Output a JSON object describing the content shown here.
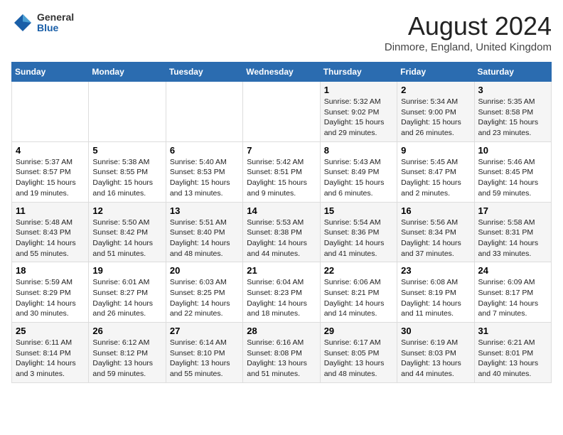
{
  "header": {
    "logo_general": "General",
    "logo_blue": "Blue",
    "title": "August 2024",
    "subtitle": "Dinmore, England, United Kingdom"
  },
  "days_of_week": [
    "Sunday",
    "Monday",
    "Tuesday",
    "Wednesday",
    "Thursday",
    "Friday",
    "Saturday"
  ],
  "weeks": [
    [
      {
        "num": "",
        "info": ""
      },
      {
        "num": "",
        "info": ""
      },
      {
        "num": "",
        "info": ""
      },
      {
        "num": "",
        "info": ""
      },
      {
        "num": "1",
        "info": "Sunrise: 5:32 AM\nSunset: 9:02 PM\nDaylight: 15 hours\nand 29 minutes."
      },
      {
        "num": "2",
        "info": "Sunrise: 5:34 AM\nSunset: 9:00 PM\nDaylight: 15 hours\nand 26 minutes."
      },
      {
        "num": "3",
        "info": "Sunrise: 5:35 AM\nSunset: 8:58 PM\nDaylight: 15 hours\nand 23 minutes."
      }
    ],
    [
      {
        "num": "4",
        "info": "Sunrise: 5:37 AM\nSunset: 8:57 PM\nDaylight: 15 hours\nand 19 minutes."
      },
      {
        "num": "5",
        "info": "Sunrise: 5:38 AM\nSunset: 8:55 PM\nDaylight: 15 hours\nand 16 minutes."
      },
      {
        "num": "6",
        "info": "Sunrise: 5:40 AM\nSunset: 8:53 PM\nDaylight: 15 hours\nand 13 minutes."
      },
      {
        "num": "7",
        "info": "Sunrise: 5:42 AM\nSunset: 8:51 PM\nDaylight: 15 hours\nand 9 minutes."
      },
      {
        "num": "8",
        "info": "Sunrise: 5:43 AM\nSunset: 8:49 PM\nDaylight: 15 hours\nand 6 minutes."
      },
      {
        "num": "9",
        "info": "Sunrise: 5:45 AM\nSunset: 8:47 PM\nDaylight: 15 hours\nand 2 minutes."
      },
      {
        "num": "10",
        "info": "Sunrise: 5:46 AM\nSunset: 8:45 PM\nDaylight: 14 hours\nand 59 minutes."
      }
    ],
    [
      {
        "num": "11",
        "info": "Sunrise: 5:48 AM\nSunset: 8:43 PM\nDaylight: 14 hours\nand 55 minutes."
      },
      {
        "num": "12",
        "info": "Sunrise: 5:50 AM\nSunset: 8:42 PM\nDaylight: 14 hours\nand 51 minutes."
      },
      {
        "num": "13",
        "info": "Sunrise: 5:51 AM\nSunset: 8:40 PM\nDaylight: 14 hours\nand 48 minutes."
      },
      {
        "num": "14",
        "info": "Sunrise: 5:53 AM\nSunset: 8:38 PM\nDaylight: 14 hours\nand 44 minutes."
      },
      {
        "num": "15",
        "info": "Sunrise: 5:54 AM\nSunset: 8:36 PM\nDaylight: 14 hours\nand 41 minutes."
      },
      {
        "num": "16",
        "info": "Sunrise: 5:56 AM\nSunset: 8:34 PM\nDaylight: 14 hours\nand 37 minutes."
      },
      {
        "num": "17",
        "info": "Sunrise: 5:58 AM\nSunset: 8:31 PM\nDaylight: 14 hours\nand 33 minutes."
      }
    ],
    [
      {
        "num": "18",
        "info": "Sunrise: 5:59 AM\nSunset: 8:29 PM\nDaylight: 14 hours\nand 30 minutes."
      },
      {
        "num": "19",
        "info": "Sunrise: 6:01 AM\nSunset: 8:27 PM\nDaylight: 14 hours\nand 26 minutes."
      },
      {
        "num": "20",
        "info": "Sunrise: 6:03 AM\nSunset: 8:25 PM\nDaylight: 14 hours\nand 22 minutes."
      },
      {
        "num": "21",
        "info": "Sunrise: 6:04 AM\nSunset: 8:23 PM\nDaylight: 14 hours\nand 18 minutes."
      },
      {
        "num": "22",
        "info": "Sunrise: 6:06 AM\nSunset: 8:21 PM\nDaylight: 14 hours\nand 14 minutes."
      },
      {
        "num": "23",
        "info": "Sunrise: 6:08 AM\nSunset: 8:19 PM\nDaylight: 14 hours\nand 11 minutes."
      },
      {
        "num": "24",
        "info": "Sunrise: 6:09 AM\nSunset: 8:17 PM\nDaylight: 14 hours\nand 7 minutes."
      }
    ],
    [
      {
        "num": "25",
        "info": "Sunrise: 6:11 AM\nSunset: 8:14 PM\nDaylight: 14 hours\nand 3 minutes."
      },
      {
        "num": "26",
        "info": "Sunrise: 6:12 AM\nSunset: 8:12 PM\nDaylight: 13 hours\nand 59 minutes."
      },
      {
        "num": "27",
        "info": "Sunrise: 6:14 AM\nSunset: 8:10 PM\nDaylight: 13 hours\nand 55 minutes."
      },
      {
        "num": "28",
        "info": "Sunrise: 6:16 AM\nSunset: 8:08 PM\nDaylight: 13 hours\nand 51 minutes."
      },
      {
        "num": "29",
        "info": "Sunrise: 6:17 AM\nSunset: 8:05 PM\nDaylight: 13 hours\nand 48 minutes."
      },
      {
        "num": "30",
        "info": "Sunrise: 6:19 AM\nSunset: 8:03 PM\nDaylight: 13 hours\nand 44 minutes."
      },
      {
        "num": "31",
        "info": "Sunrise: 6:21 AM\nSunset: 8:01 PM\nDaylight: 13 hours\nand 40 minutes."
      }
    ]
  ]
}
